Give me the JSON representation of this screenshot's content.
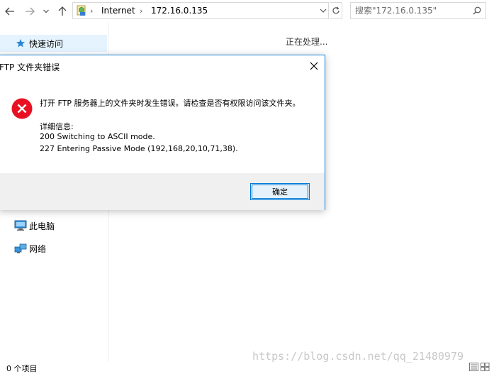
{
  "address_bar": {
    "crumbs": [
      "Internet",
      "172.16.0.135"
    ]
  },
  "search": {
    "placeholder": "搜索\"172.16.0.135\""
  },
  "left_pane": {
    "items": [
      {
        "label": "快速访问",
        "icon": "star-icon",
        "selected": true
      },
      {
        "label": "此电脑",
        "icon": "computer-icon"
      },
      {
        "label": "网络",
        "icon": "network-icon"
      }
    ]
  },
  "content": {
    "status": "正在处理..."
  },
  "dialog": {
    "title": "FTP 文件夹错误",
    "message": "打开 FTP 服务器上的文件夹时发生错误。请检查是否有权限访问该文件夹。",
    "details_heading": "详细信息:",
    "details": [
      "200 Switching to ASCII mode.",
      "227 Entering Passive Mode (192,168,20,10,71,38)."
    ],
    "ok_label": "确定"
  },
  "statusbar": {
    "count": "0 个项目"
  },
  "watermark": "https://blog.csdn.net/qq_21480979",
  "colors": {
    "accent": "#0078d7",
    "error": "#e81123",
    "selected_bg": "#e5f3ff"
  }
}
